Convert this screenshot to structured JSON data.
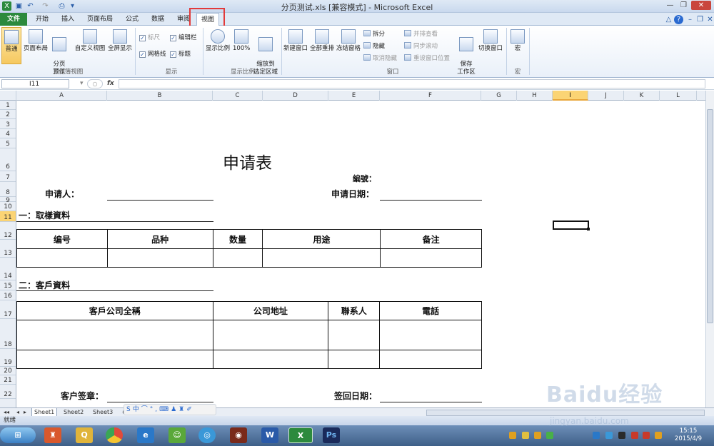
{
  "window": {
    "title": "分页测试.xls  [兼容模式] - Microsoft Excel"
  },
  "ribbon_tabs": [
    "文件",
    "开始",
    "插入",
    "页面布局",
    "公式",
    "数据",
    "审阅",
    "视图"
  ],
  "ribbon": {
    "workbook_views": {
      "normal": "普通",
      "page_layout": "页面布局",
      "page_break": "分页\n预览",
      "custom": "自定义视图",
      "fullscreen": "全屏显示",
      "group": "工作簿视图"
    },
    "show": {
      "ruler": "标尺",
      "formula_bar": "编辑栏",
      "gridlines": "网格线",
      "headings": "标题",
      "group": "显示"
    },
    "zoom": {
      "zoom": "显示比例",
      "hundred": "100%",
      "to_selection": "缩放到\n选定区域",
      "group": "显示比例"
    },
    "window": {
      "new_window": "新建窗口",
      "arrange_all": "全部重排",
      "freeze": "冻结窗格",
      "split": "拆分",
      "hide": "隐藏",
      "unhide": "取消隐藏",
      "side_by_side": "并排查看",
      "sync_scroll": "同步滚动",
      "reset_pos": "重设窗口位置",
      "save_ws": "保存\n工作区",
      "switch": "切换窗口",
      "group": "窗口"
    },
    "macros": {
      "macro": "宏",
      "group": "宏"
    }
  },
  "formula_bar": {
    "name_box": "I11",
    "fx": "fx",
    "value": ""
  },
  "columns": [
    "A",
    "B",
    "C",
    "D",
    "E",
    "F",
    "G",
    "H",
    "I",
    "J",
    "K",
    "L"
  ],
  "selected_column": "I",
  "rows": [
    "1",
    "2",
    "3",
    "4",
    "5",
    "6",
    "7",
    "8",
    "9",
    "10",
    "11",
    "12",
    "13",
    "14",
    "15",
    "16",
    "17",
    "18",
    "19",
    "20",
    "21",
    "22"
  ],
  "selected_row": "11",
  "document": {
    "title": "申请表",
    "serial_label": "編號：",
    "applicant_label": "申请人：",
    "apply_date_label": "申请日期：",
    "section1": "一：取樣資料",
    "table1_headers": [
      "编号",
      "品种",
      "数量",
      "用途",
      "备注"
    ],
    "section2": "二：客戶資料",
    "table2_headers": [
      "客戶公司全稱",
      "公司地址",
      "聯系人",
      "電話"
    ],
    "customer_sign_label": "客户签章：",
    "return_date_label": "签回日期："
  },
  "sheet_tabs": [
    "Sheet1",
    "Sheet2",
    "Sheet3"
  ],
  "status": {
    "ready": "就绪"
  },
  "clock": {
    "time": "15:15",
    "date": "2015/4/9"
  },
  "watermark": {
    "brand": "Baidu经验",
    "site": "jingyan.baidu.com"
  },
  "colors": {
    "file_tab": "#2c8a3d",
    "highlight": "#e23a3a",
    "selection": "#fbd474"
  }
}
